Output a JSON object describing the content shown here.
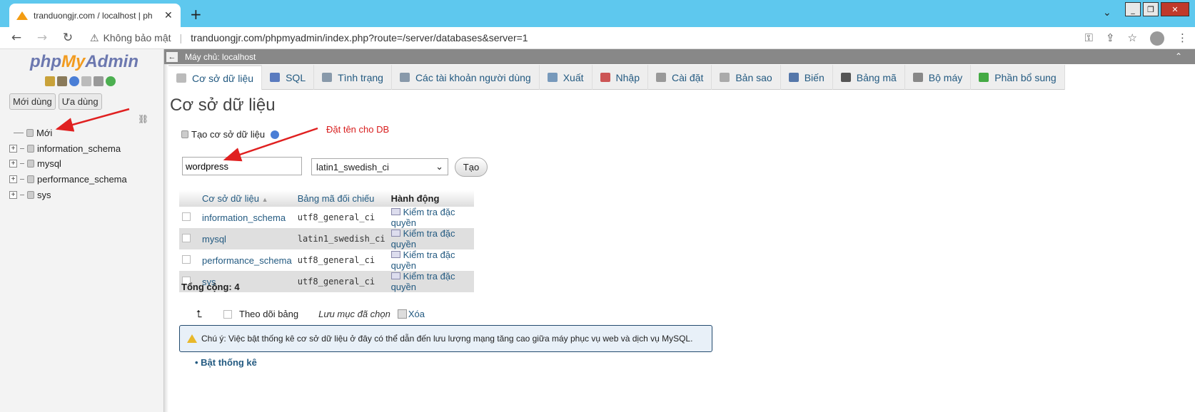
{
  "browser": {
    "tab_title": "tranduongjr.com / localhost | ph",
    "close_glyph": "✕",
    "newtab_glyph": "+",
    "insecure_label": "Không bảo mật",
    "url": "tranduongjr.com/phpmyadmin/index.php?route=/server/databases&server=1"
  },
  "sidebar": {
    "logo": {
      "php": "php",
      "my": "My",
      "admin": "Admin"
    },
    "btn_recent": "Mới dùng",
    "btn_favorite": "Ưa dùng",
    "tree": [
      {
        "label": "Mới",
        "expandable": false
      },
      {
        "label": "information_schema",
        "expandable": true
      },
      {
        "label": "mysql",
        "expandable": true
      },
      {
        "label": "performance_schema",
        "expandable": true
      },
      {
        "label": "sys",
        "expandable": true
      }
    ]
  },
  "topbar": {
    "server": "Máy chủ: localhost"
  },
  "tabs": [
    {
      "label": "Cơ sở dữ liệu",
      "icon": "database-icon",
      "color": "#bbbbbb",
      "active": true
    },
    {
      "label": "SQL",
      "icon": "sql-icon",
      "color": "#5a7bbf"
    },
    {
      "label": "Tình trạng",
      "icon": "status-icon",
      "color": "#8899aa"
    },
    {
      "label": "Các tài khoản người dùng",
      "icon": "users-icon",
      "color": "#8899aa"
    },
    {
      "label": "Xuất",
      "icon": "export-icon",
      "color": "#7799bb"
    },
    {
      "label": "Nhập",
      "icon": "import-icon",
      "color": "#cc5555"
    },
    {
      "label": "Cài đặt",
      "icon": "wrench-icon",
      "color": "#999999"
    },
    {
      "label": "Bản sao",
      "icon": "replication-icon",
      "color": "#aaaaaa"
    },
    {
      "label": "Biến",
      "icon": "variables-icon",
      "color": "#5577aa"
    },
    {
      "label": "Bảng mã",
      "icon": "charset-icon",
      "color": "#555555"
    },
    {
      "label": "Bộ máy",
      "icon": "engine-icon",
      "color": "#888888"
    },
    {
      "label": "Phần bổ sung",
      "icon": "plugin-icon",
      "color": "#44aa44"
    }
  ],
  "main": {
    "title": "Cơ sở dữ liệu",
    "create_label": "Tạo cơ sở dữ liệu",
    "annotation": "Đặt tên cho DB",
    "db_name_value": "wordpress",
    "collation_value": "latin1_swedish_ci",
    "create_button": "Tạo",
    "table": {
      "headers": [
        "Cơ sở dữ liệu",
        "Bảng mã đối chiếu",
        "Hành động"
      ],
      "sort_glyph": "▲",
      "rows": [
        {
          "db": "information_schema",
          "collation": "utf8_general_ci",
          "action": "Kiểm tra đặc quyền"
        },
        {
          "db": "mysql",
          "collation": "latin1_swedish_ci",
          "action": "Kiểm tra đặc quyền"
        },
        {
          "db": "performance_schema",
          "collation": "utf8_general_ci",
          "action": "Kiểm tra đặc quyền"
        },
        {
          "db": "sys",
          "collation": "utf8_general_ci",
          "action": "Kiểm tra đặc quyền"
        }
      ]
    },
    "total": "Tổng cộng: 4",
    "bulk": {
      "check_all": "Theo dõi bảng",
      "with_selected": "Lưu mục đã chọn",
      "drop": "Xóa"
    },
    "notice": "Chú ý: Việc bật thống kê cơ sở dữ liệu ở đây có thể dẫn đến lưu lượng mạng tăng cao giữa máy phục vụ web và dịch vụ MySQL.",
    "enable_stats": "Bật thống kê"
  },
  "colors": {
    "link": "#235a81",
    "annotation": "#d81e1e",
    "arrow": "#e02020",
    "chrome": "#5ec8ee"
  }
}
